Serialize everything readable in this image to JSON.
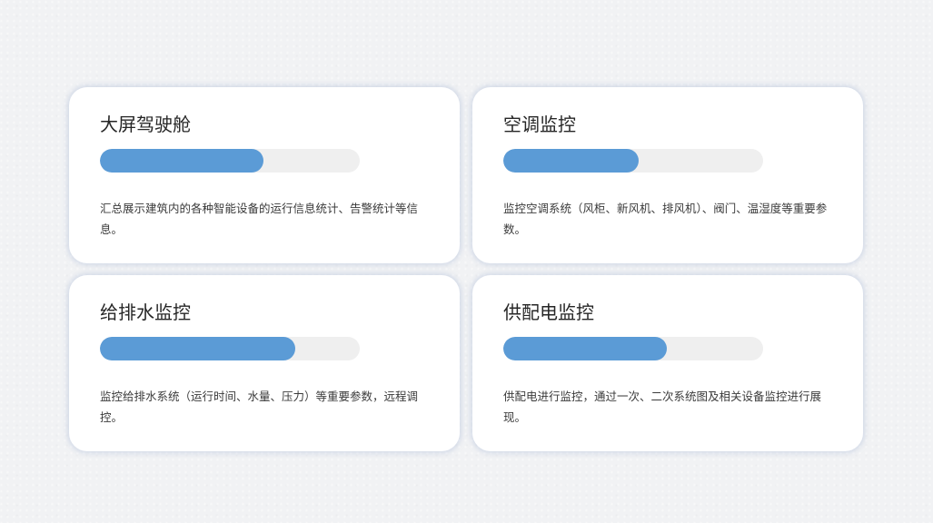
{
  "cards": [
    {
      "title": "大屏驾驶舱",
      "progress": 0.63,
      "description": "汇总展示建筑内的各种智能设备的运行信息统计、告警统计等信息。"
    },
    {
      "title": "空调监控",
      "progress": 0.52,
      "description": "监控空调系统（风柜、新风机、排风机）、阀门、温湿度等重要参数。"
    },
    {
      "title": "给排水监控",
      "progress": 0.75,
      "description": "监控给排水系统（运行时间、水量、压力）等重要参数，远程调控。"
    },
    {
      "title": "供配电监控",
      "progress": 0.63,
      "description": "供配电进行监控，通过一次、二次系统图及相关设备监控进行展现。"
    }
  ],
  "colors": {
    "progress_fill": "#5b9bd6",
    "progress_track": "#efefef"
  }
}
